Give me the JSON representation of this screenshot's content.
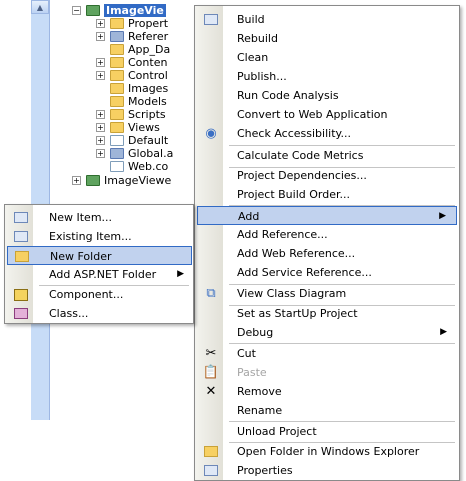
{
  "tree": {
    "items": [
      {
        "label": "ImageVie",
        "type": "project",
        "selected": true
      },
      {
        "label": "Propert",
        "type": "folder",
        "expander": "+"
      },
      {
        "label": "Referer",
        "type": "folder",
        "expander": "+"
      },
      {
        "label": "App_Da",
        "type": "folder"
      },
      {
        "label": "Conten",
        "type": "folder",
        "expander": "+"
      },
      {
        "label": "Control",
        "type": "folder",
        "expander": "+"
      },
      {
        "label": "Images",
        "type": "folder"
      },
      {
        "label": "Models",
        "type": "folder"
      },
      {
        "label": "Scripts",
        "type": "folder",
        "expander": "+"
      },
      {
        "label": "Views",
        "type": "folder",
        "expander": "+"
      },
      {
        "label": "Default",
        "type": "page",
        "expander": "+"
      },
      {
        "label": "Global.a",
        "type": "gear",
        "expander": "+"
      },
      {
        "label": "Web.co",
        "type": "page"
      },
      {
        "label": "ImageViewe",
        "type": "project",
        "expander": "+"
      }
    ]
  },
  "context_menu": {
    "items": [
      {
        "label": "Build",
        "icon": "build-icon"
      },
      {
        "label": "Rebuild"
      },
      {
        "label": "Clean"
      },
      {
        "label": "Publish..."
      },
      {
        "label": "Run Code Analysis"
      },
      {
        "label": "Convert to Web Application"
      },
      {
        "label": "Check Accessibility...",
        "icon": "accessibility-icon"
      },
      {
        "label": "Calculate Code Metrics"
      },
      {
        "label": "Project Dependencies..."
      },
      {
        "label": "Project Build Order..."
      },
      {
        "label": "Add",
        "submenu": true,
        "highlighted": true
      },
      {
        "label": "Add Reference..."
      },
      {
        "label": "Add Web Reference..."
      },
      {
        "label": "Add Service Reference..."
      },
      {
        "label": "View Class Diagram",
        "icon": "class-diagram-icon"
      },
      {
        "label": "Set as StartUp Project"
      },
      {
        "label": "Debug",
        "submenu": true
      },
      {
        "label": "Cut",
        "icon": "cut-icon"
      },
      {
        "label": "Paste",
        "icon": "paste-icon",
        "disabled": true
      },
      {
        "label": "Remove",
        "icon": "remove-icon"
      },
      {
        "label": "Rename"
      },
      {
        "label": "Unload Project"
      },
      {
        "label": "Open Folder in Windows Explorer",
        "icon": "open-folder-icon"
      },
      {
        "label": "Properties",
        "icon": "properties-icon"
      }
    ]
  },
  "add_submenu": {
    "items": [
      {
        "label": "New Item...",
        "icon": "new-item-icon"
      },
      {
        "label": "Existing Item...",
        "icon": "existing-item-icon"
      },
      {
        "label": "New Folder",
        "icon": "new-folder-icon",
        "highlighted": true
      },
      {
        "label": "Add ASP.NET Folder",
        "submenu": true
      },
      {
        "label": "Component...",
        "icon": "component-icon"
      },
      {
        "label": "Class...",
        "icon": "class-icon"
      }
    ]
  },
  "colors": {
    "highlight_fill": "#c1d2ee",
    "highlight_border": "#316ac5",
    "selection": "#316ac5"
  }
}
